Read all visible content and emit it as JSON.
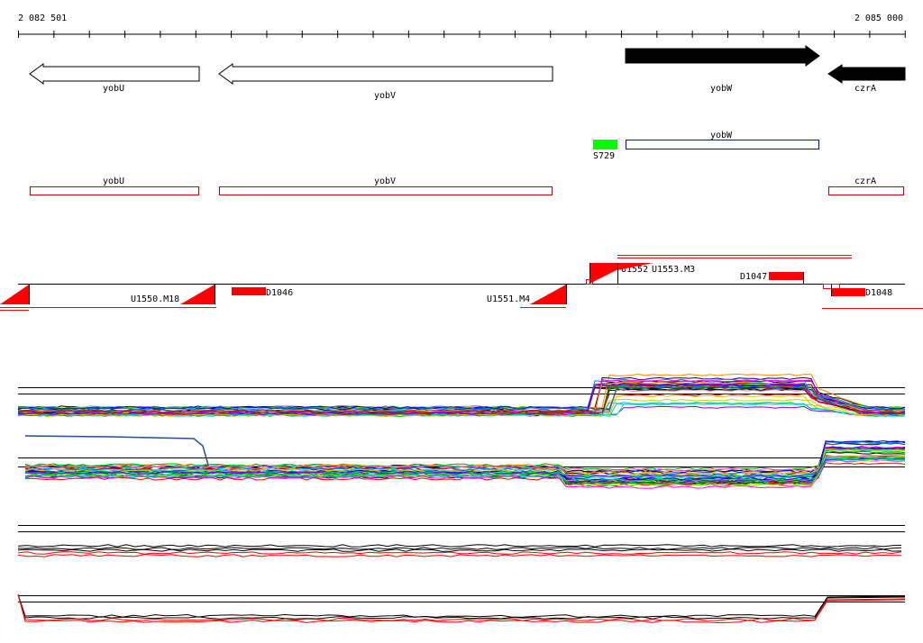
{
  "ruler": {
    "start_label": "2 082 501",
    "end_label": "2 085 000"
  },
  "genes": [
    {
      "name": "yobU",
      "strand": "-",
      "fill": "white"
    },
    {
      "name": "yobV",
      "strand": "-",
      "fill": "white"
    },
    {
      "name": "yobW",
      "strand": "+",
      "fill": "black"
    },
    {
      "name": "czrA",
      "strand": "-",
      "fill": "black"
    }
  ],
  "annotation_boxes": [
    {
      "name": "yobW",
      "color": "#0000ff"
    },
    {
      "name": "yobU",
      "color": "#cc0000"
    },
    {
      "name": "yobV",
      "color": "#cc0000"
    },
    {
      "name": "czrA",
      "color": "#cc0000"
    }
  ],
  "green_feature": {
    "label": "S729",
    "color": "#00ff00"
  },
  "transcription_features": [
    {
      "label": "U1550.M18"
    },
    {
      "label": "D1046"
    },
    {
      "label": "U1551.M4"
    },
    {
      "label": "U1552"
    },
    {
      "label": "U1553.M3"
    },
    {
      "label": "D1047"
    },
    {
      "label": "D1048"
    }
  ],
  "colors": {
    "up": "#ff0000",
    "down": "#000000",
    "black_gene": "#000000",
    "blue_box": "#0000ff",
    "red_box": "#cc0000",
    "green": "#00ff00"
  },
  "expression_panels": [
    {
      "name": "expression-panel-1"
    },
    {
      "name": "expression-panel-2"
    },
    {
      "name": "expression-panel-3"
    },
    {
      "name": "expression-panel-4"
    }
  ]
}
